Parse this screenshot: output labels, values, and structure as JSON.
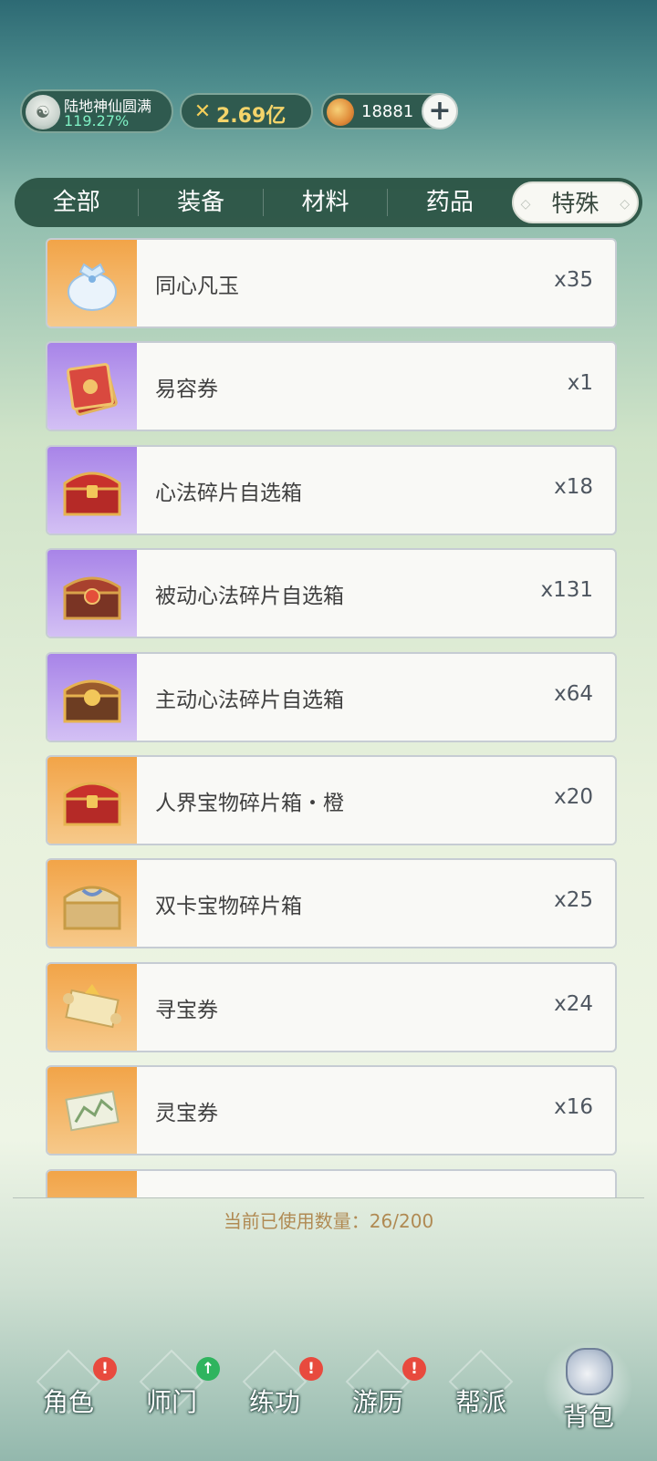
{
  "status": {
    "realm_title": "陆地神仙圆满",
    "realm_progress": "119.27%",
    "power": "2.69亿",
    "currency": "18881",
    "add_label": "+"
  },
  "tabs": [
    {
      "label": "全部",
      "active": false
    },
    {
      "label": "装备",
      "active": false
    },
    {
      "label": "材料",
      "active": false
    },
    {
      "label": "药品",
      "active": false
    },
    {
      "label": "特殊",
      "active": true
    }
  ],
  "items": [
    {
      "name": "同心凡玉",
      "count": "x35",
      "rarity": "orange",
      "icon": "jade-bag-icon"
    },
    {
      "name": "易容券",
      "count": "x1",
      "rarity": "purple",
      "icon": "disguise-ticket-icon"
    },
    {
      "name": "心法碎片自选箱",
      "count": "x18",
      "rarity": "purple",
      "icon": "red-chest-icon"
    },
    {
      "name": "被动心法碎片自选箱",
      "count": "x131",
      "rarity": "purple",
      "icon": "red-chest-icon"
    },
    {
      "name": "主动心法碎片自选箱",
      "count": "x64",
      "rarity": "purple",
      "icon": "gold-chest-icon"
    },
    {
      "name": "人界宝物碎片箱・橙",
      "count": "x20",
      "rarity": "orange",
      "icon": "red-chest-icon"
    },
    {
      "name": "双卡宝物碎片箱",
      "count": "x25",
      "rarity": "orange",
      "icon": "gold-chest-icon"
    },
    {
      "name": "寻宝券",
      "count": "x24",
      "rarity": "orange",
      "icon": "scroll-icon"
    },
    {
      "name": "灵宝券",
      "count": "x16",
      "rarity": "orange",
      "icon": "map-scroll-icon"
    }
  ],
  "usage_text": "当前已使用数量：26/200",
  "nav": [
    {
      "label": "角色",
      "badge": "!",
      "badge_color": "#e84a3e"
    },
    {
      "label": "师门",
      "badge": "↑",
      "badge_color": "#2fb45e"
    },
    {
      "label": "练功",
      "badge": "!",
      "badge_color": "#e84a3e"
    },
    {
      "label": "游历",
      "badge": "!",
      "badge_color": "#e84a3e"
    },
    {
      "label": "帮派",
      "badge": "",
      "badge_color": ""
    },
    {
      "label": "背包",
      "badge": "",
      "badge_color": "",
      "active": true
    }
  ]
}
